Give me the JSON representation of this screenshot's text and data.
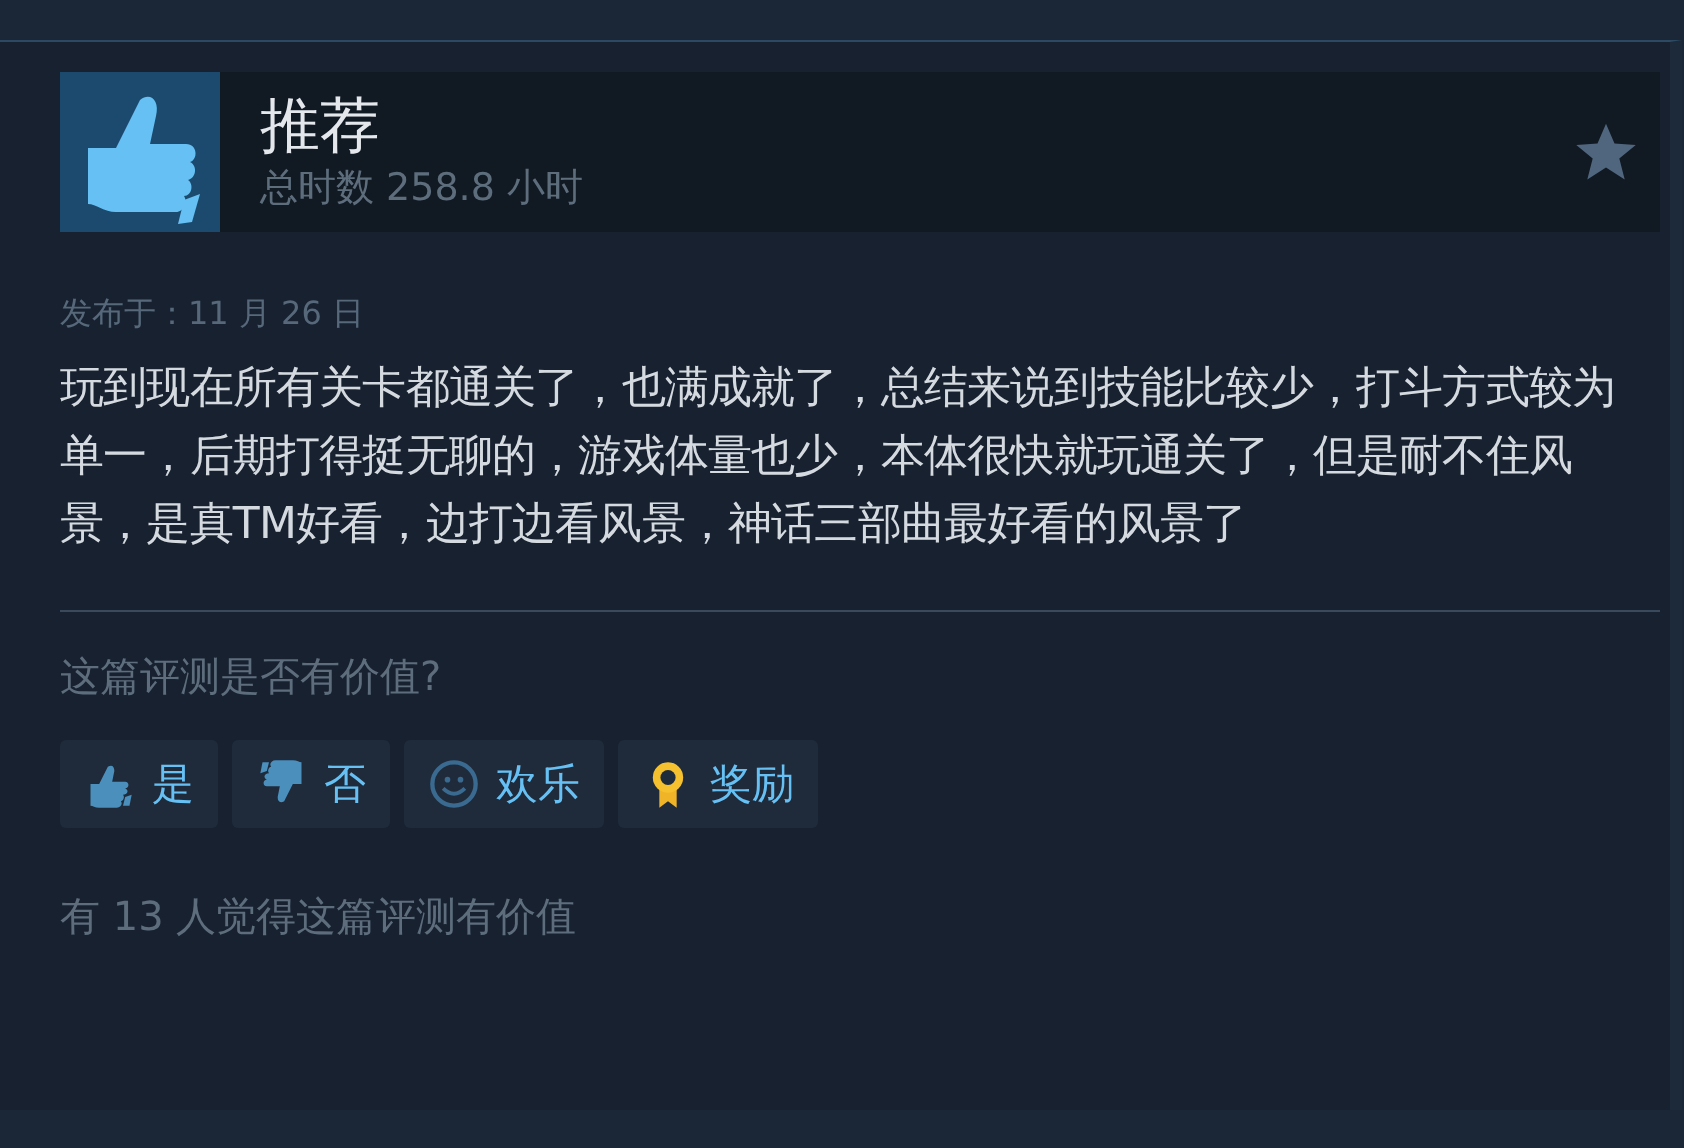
{
  "review": {
    "verdict": "推荐",
    "playtime": "总时数 258.8 小时",
    "posted": "发布于：11 月 26 日",
    "text": "玩到现在所有关卡都通关了，也满成就了，总结来说到技能比较少，打斗方式较为单一，后期打得挺无聊的，游戏体量也少，本体很快就玩通关了，但是耐不住风景，是真TM好看，边打边看风景，神话三部曲最好看的风景了"
  },
  "helpful": {
    "question": "这篇评测是否有价值?",
    "buttons": [
      {
        "kind": "yes",
        "label": "是"
      },
      {
        "kind": "no",
        "label": "否"
      },
      {
        "kind": "funny",
        "label": "欢乐"
      },
      {
        "kind": "award",
        "label": "奖励"
      }
    ],
    "summary": "有 13 人觉得这篇评测有价值"
  }
}
